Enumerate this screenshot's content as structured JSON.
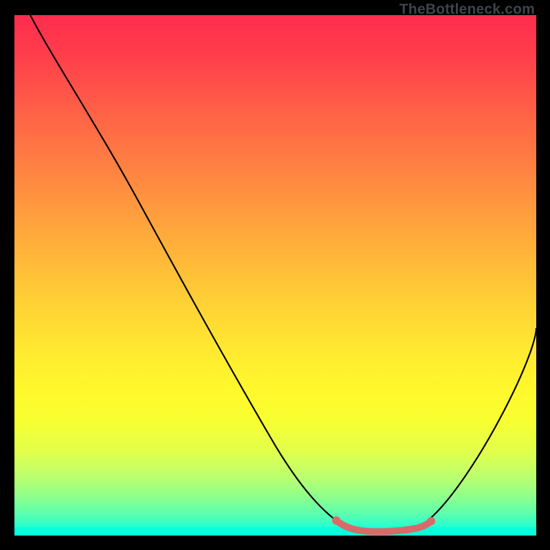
{
  "watermark": "TheBottleneck.com",
  "chart_data": {
    "type": "line",
    "title": "",
    "xlabel": "",
    "ylabel": "",
    "xlim": [
      0,
      100
    ],
    "ylim": [
      0,
      100
    ],
    "background_gradient": {
      "top": "#ff2c4e",
      "mid": "#ffe830",
      "bottom": "#04ffe8"
    },
    "series": [
      {
        "name": "bottleneck-curve",
        "color": "#000000",
        "x": [
          3,
          10,
          20,
          30,
          40,
          50,
          58,
          62,
          66,
          70,
          73,
          76,
          80,
          86,
          92,
          100
        ],
        "y": [
          100,
          90,
          75,
          60,
          45,
          30,
          17,
          10,
          4,
          1,
          0,
          0,
          1,
          8,
          20,
          40
        ]
      },
      {
        "name": "optimal-zone-marker",
        "color": "#d96a6a",
        "x": [
          62,
          66,
          70,
          73,
          76,
          79
        ],
        "y": [
          2.5,
          1.2,
          0.8,
          0.8,
          1.0,
          2.2
        ]
      }
    ],
    "annotations": []
  }
}
